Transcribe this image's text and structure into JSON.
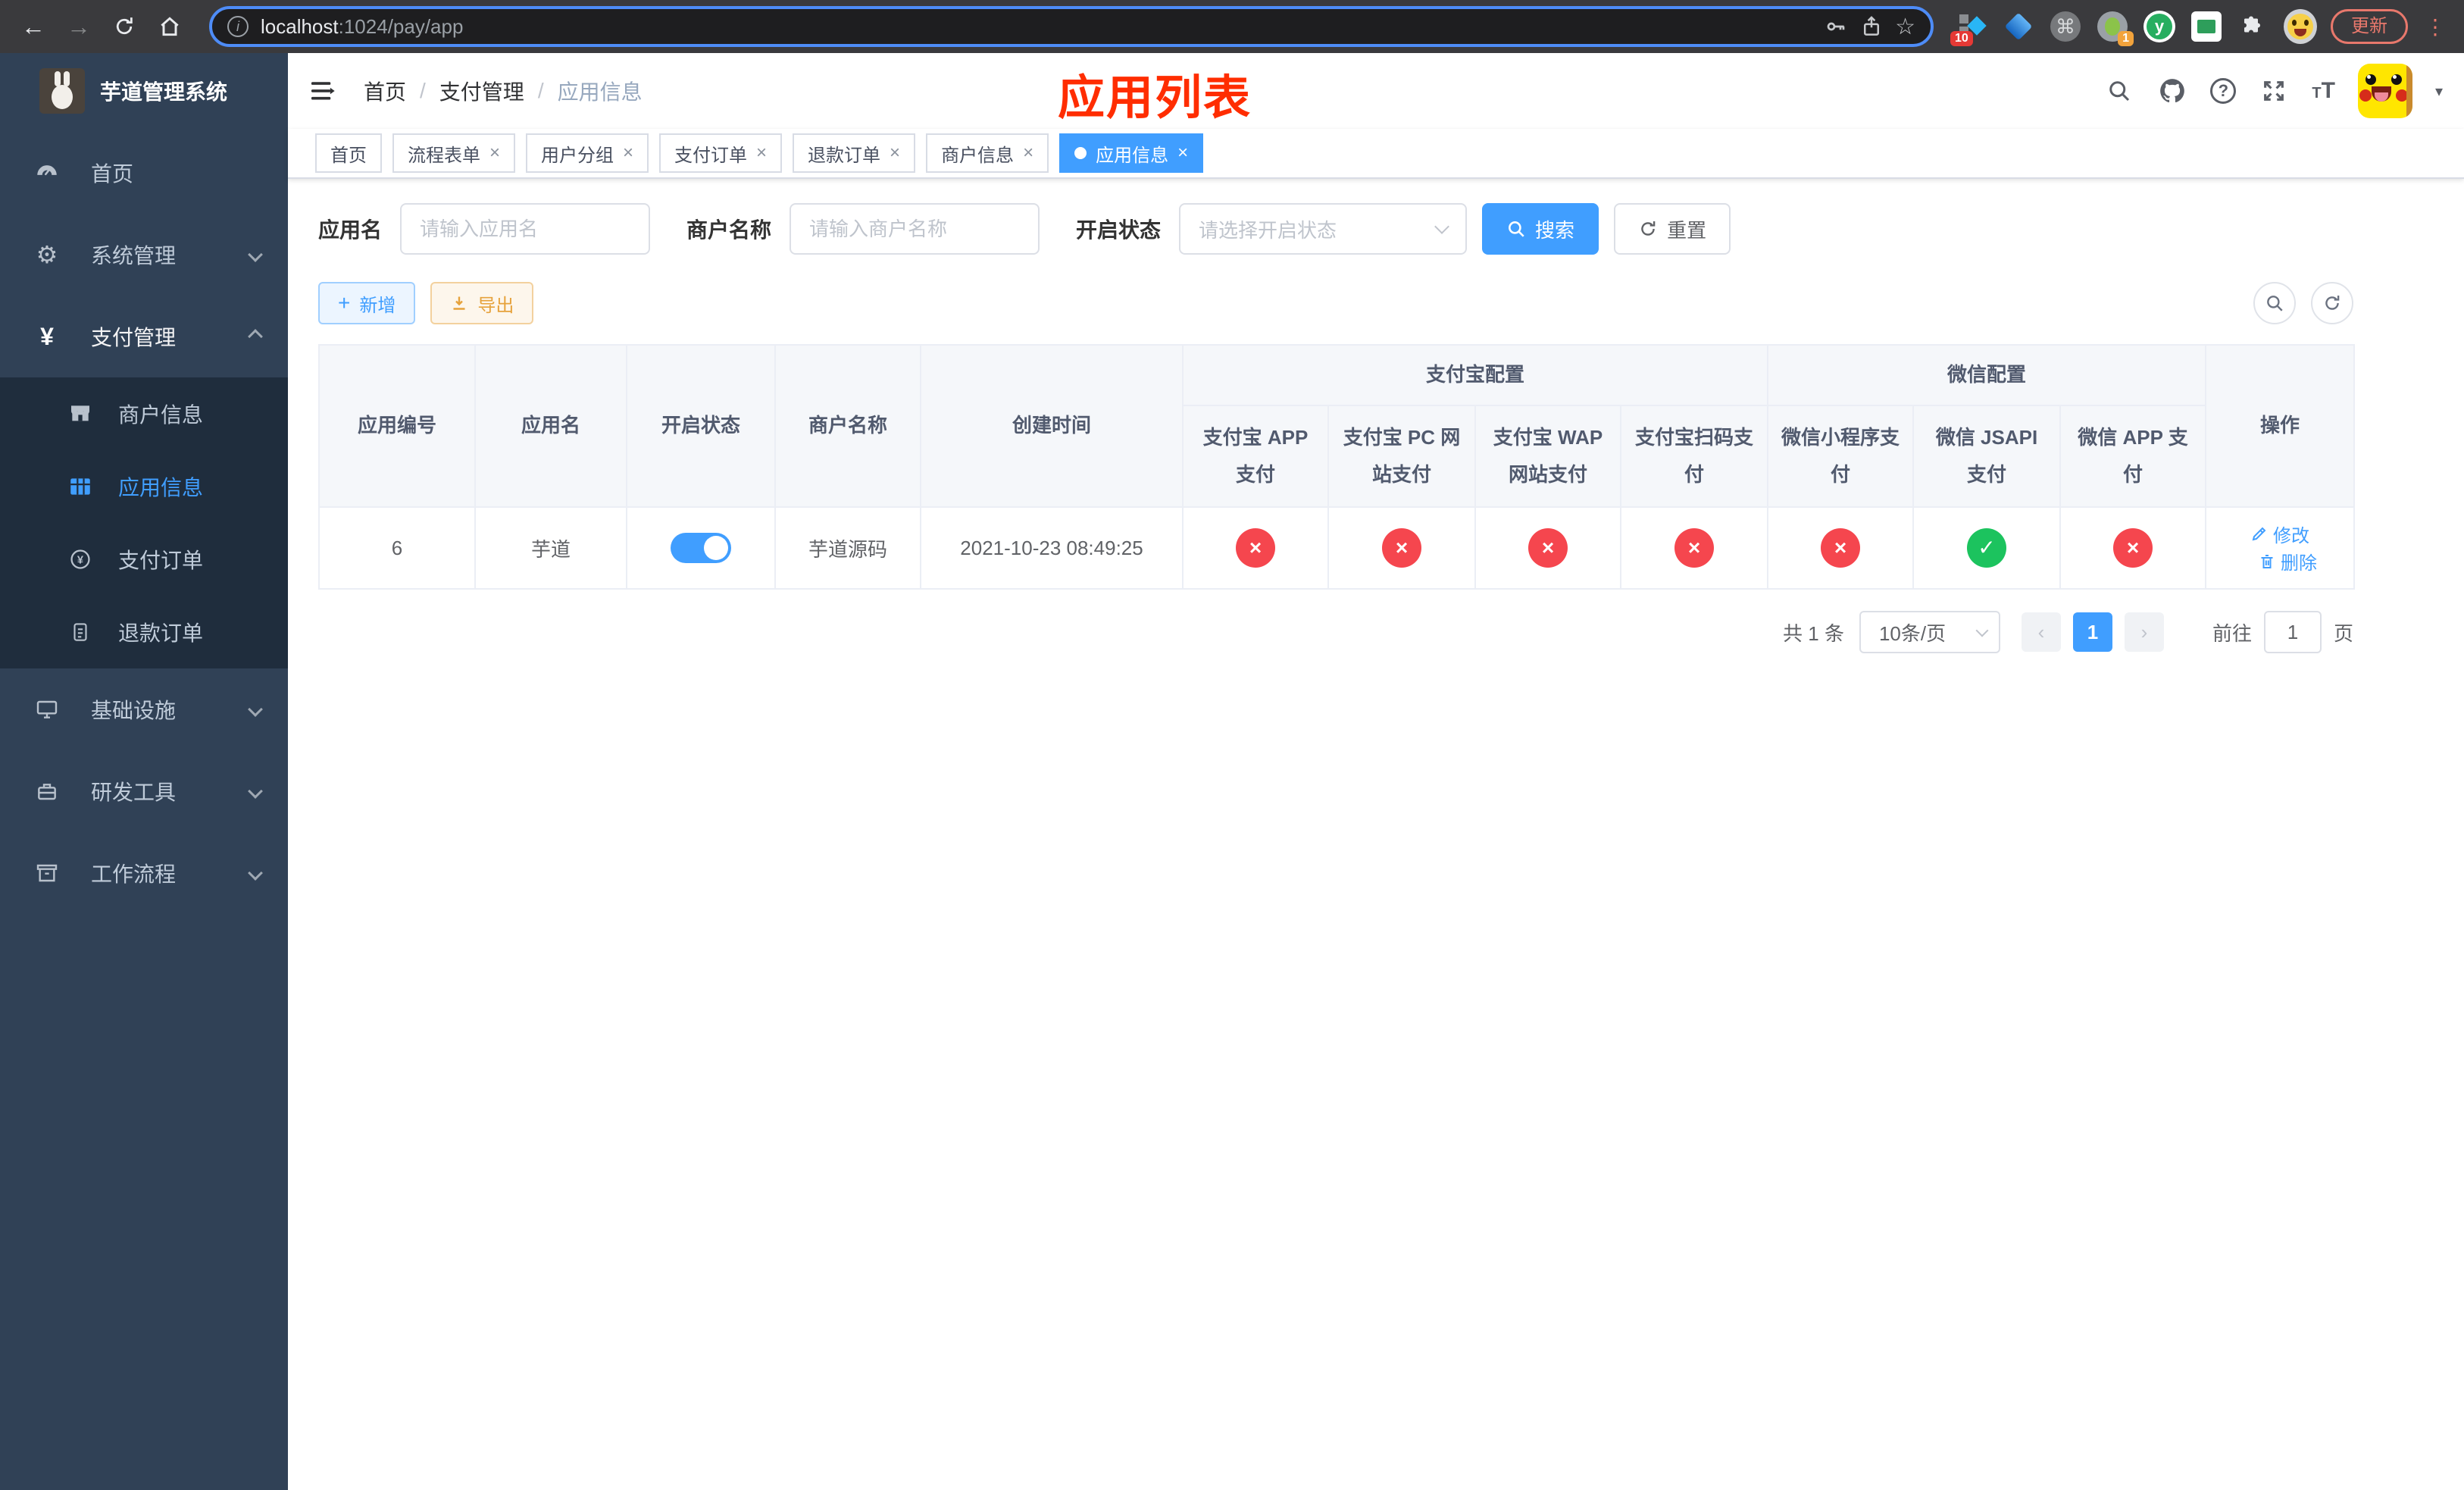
{
  "colors": {
    "accent": "#409eff",
    "danger": "#f5464e",
    "success": "#1cc35e",
    "warning": "#e6a23c",
    "sidebar_bg": "#304156",
    "submenu_bg": "#1f2d3d",
    "title_red": "#ff2d00"
  },
  "browser": {
    "back_glyph": "←",
    "forward_glyph": "→",
    "url_host": "localhost",
    "url_path": ":1024/pay/app",
    "star_glyph": "☆",
    "info_glyph": "i",
    "command_glyph": "⌘",
    "y_glyph": "y",
    "ext_badge_blocks": "10",
    "ext_badge_green": "1",
    "update_label": "更新",
    "menu_dots_glyph": "⋮"
  },
  "sidebar": {
    "logo_title": "芋道管理系统",
    "items": [
      {
        "label": "首页"
      },
      {
        "label": "系统管理"
      },
      {
        "label": "支付管理"
      },
      {
        "label": "基础设施"
      },
      {
        "label": "研发工具"
      },
      {
        "label": "工作流程"
      }
    ],
    "pay_submenu": [
      {
        "label": "商户信息"
      },
      {
        "label": "应用信息"
      },
      {
        "label": "支付订单"
      },
      {
        "label": "退款订单"
      }
    ],
    "yen_glyph": "¥",
    "gear_glyph": "⚙"
  },
  "header": {
    "breadcrumb": [
      "首页",
      "支付管理",
      "应用信息"
    ],
    "separator": "/",
    "title_overlay": "应用列表",
    "help_glyph": "?",
    "caret_glyph": "▾",
    "font_big": "T",
    "font_small": "T"
  },
  "tabs": {
    "close_glyph": "×",
    "items": [
      {
        "label": "首页"
      },
      {
        "label": "流程表单"
      },
      {
        "label": "用户分组"
      },
      {
        "label": "支付订单"
      },
      {
        "label": "退款订单"
      },
      {
        "label": "商户信息"
      },
      {
        "label": "应用信息"
      }
    ]
  },
  "filters": {
    "app_name_label": "应用名",
    "app_name_placeholder": "请输入应用名",
    "merchant_label": "商户名称",
    "merchant_placeholder": "请输入商户名称",
    "status_label": "开启状态",
    "status_placeholder": "请选择开启状态",
    "search_label": "搜索",
    "reset_label": "重置"
  },
  "toolbar": {
    "add_label": "新增",
    "export_label": "导出",
    "plus_glyph": "+"
  },
  "table": {
    "columns": {
      "app_id": "应用编号",
      "app_name": "应用名",
      "enabled": "开启状态",
      "merchant": "商户名称",
      "created": "创建时间",
      "alipay_group": "支付宝配置",
      "wechat_group": "微信配置",
      "actions": "操作",
      "alipay": [
        "支付宝 APP 支付",
        "支付宝 PC 网站支付",
        "支付宝 WAP 网站支付",
        "支付宝扫码支付"
      ],
      "wechat": [
        "微信小程序支付",
        "微信 JSAPI 支付",
        "微信 APP 支付"
      ]
    },
    "status_glyphs": {
      "pass": "✓",
      "fail": "×"
    },
    "rows": [
      {
        "app_id": "6",
        "app_name": "芋道",
        "enabled": true,
        "merchant": "芋道源码",
        "created": "2021-10-23 08:49:25",
        "channel_status": [
          false,
          false,
          false,
          false,
          false,
          true,
          false
        ],
        "actions": {
          "edit": "修改",
          "delete": "删除"
        }
      }
    ]
  },
  "pagination": {
    "total": "共 1 条",
    "page_size": "10条/页",
    "prev_glyph": "‹",
    "next_glyph": "›",
    "page": "1",
    "goto_label": "前往",
    "goto_value": "1",
    "unit": "页"
  }
}
